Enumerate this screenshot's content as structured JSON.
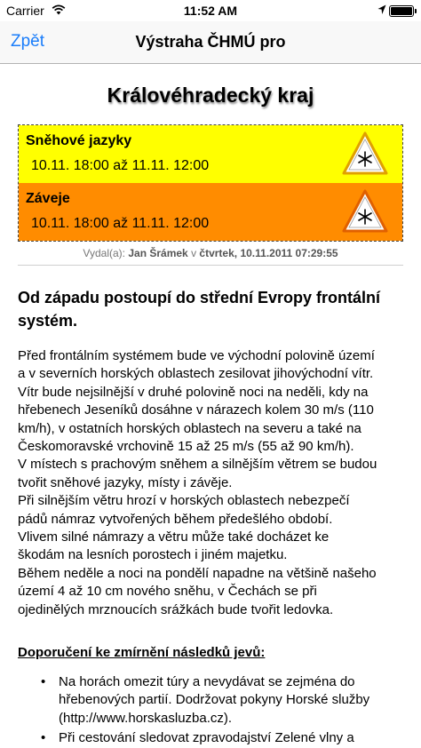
{
  "status_bar": {
    "carrier": "Carrier",
    "time": "11:52 AM"
  },
  "nav": {
    "back_label": "Zpět",
    "title": "Výstraha ČHMÚ pro"
  },
  "region": "Královéhradecký kraj",
  "warnings": [
    {
      "name": "Sněhové jazyky",
      "range": "10.11. 18:00 až 11.11. 12:00",
      "color": "#ffff00"
    },
    {
      "name": "Záveje",
      "range": "10.11. 18:00 až 11.11. 12:00",
      "color": "#ff8c00"
    }
  ],
  "issuer": {
    "prefix": "Vydal(a):",
    "name": "Jan Šrámek",
    "connector": "v",
    "date": "čtvrtek, 10.11.2011 07:29:55"
  },
  "headline": "Od západu postoupí do střední Evropy frontální systém.",
  "body_lines": [
    "Před frontálním systémem bude ve východní polovině území",
    "a v severních horských oblastech zesilovat jihovýchodní vítr.",
    "Vítr bude nejsilnější v druhé polovině noci na neděli, kdy na",
    "hřebenech Jeseníků dosáhne v nárazech kolem 30 m/s (110",
    "km/h), v ostatních horských oblastech na severu a také na",
    "Českomoravské vrchovině 15 až 25 m/s (55 až 90 km/h).",
    "V místech s prachovým sněhem a silnějším větrem se budou",
    "tvořit sněhové jazyky, místy i závěje.",
    "Při silnějším větru hrozí v horských oblastech nebezpečí",
    "pádů námraz vytvořených během předešlého období.",
    "Vlivem silné námrazy a větru může také docházet ke",
    "škodám na lesních porostech i jiném majetku.",
    "Během neděle a noci na pondělí napadne na většině našeho",
    "území 4 až 10 cm nového sněhu, v Čechách se při",
    "ojedinělých mrznoucích srážkách bude tvořit ledovka."
  ],
  "recommendations": {
    "title": "Doporučení ke zmírnění následků jevů:",
    "items": [
      "Na horách omezit túry a nevydávat se zejména do hřebenových partií. Dodržovat pokyny Horské služby (http://www.horskasluzba.cz).",
      "Při cestování sledovat zpravodajství Zelené vlny a"
    ]
  }
}
